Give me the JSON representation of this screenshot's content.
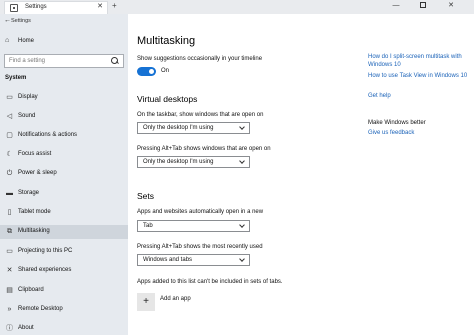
{
  "window": {
    "tab_title": "Settings",
    "tab_close": "✕",
    "new_tab": "+",
    "minimize": "—",
    "close": "✕"
  },
  "sidebar": {
    "back": "←",
    "title": "Settings",
    "home": "Home",
    "search_placeholder": "Find a setting",
    "section": "System",
    "items": [
      {
        "label": "Display",
        "icon": "display-icon"
      },
      {
        "label": "Sound",
        "icon": "speaker-icon"
      },
      {
        "label": "Notifications & actions",
        "icon": "notifications-icon"
      },
      {
        "label": "Focus assist",
        "icon": "moon-icon"
      },
      {
        "label": "Power & sleep",
        "icon": "power-icon"
      },
      {
        "label": "Storage",
        "icon": "storage-icon"
      },
      {
        "label": "Tablet mode",
        "icon": "tablet-icon"
      },
      {
        "label": "Multitasking",
        "icon": "multitasking-icon"
      },
      {
        "label": "Projecting to this PC",
        "icon": "projecting-icon"
      },
      {
        "label": "Shared experiences",
        "icon": "shared-icon"
      },
      {
        "label": "Clipboard",
        "icon": "clipboard-icon"
      },
      {
        "label": "Remote Desktop",
        "icon": "remote-desktop-icon"
      },
      {
        "label": "About",
        "icon": "info-icon"
      }
    ]
  },
  "main": {
    "title": "Multitasking",
    "timeline_label": "Show suggestions occasionally in your timeline",
    "toggle_state": "On",
    "virtual_desktops": {
      "heading": "Virtual desktops",
      "taskbar_label": "On the taskbar, show windows that are open on",
      "taskbar_value": "Only the desktop I'm using",
      "alttab_label": "Pressing Alt+Tab shows windows that are open on",
      "alttab_value": "Only the desktop I'm using"
    },
    "sets": {
      "heading": "Sets",
      "apps_label": "Apps and websites automatically open in a new",
      "apps_value": "Tab",
      "alttab_label": "Pressing Alt+Tab shows the most recently used",
      "alttab_value": "Windows and tabs",
      "exclusion_label": "Apps added to this list can't be included in sets of tabs.",
      "add_label": "Add an app"
    }
  },
  "right": {
    "link1": "How do I split-screen multitask with Windows 10",
    "link2": "How to use Task View in Windows 10",
    "link3": "Get help",
    "better_label": "Make Windows better",
    "feedback_link": "Give us feedback"
  },
  "colors": {
    "accent": "#1672d4",
    "link": "#1a62b8",
    "sidebar_bg": "#e6eaef",
    "active_item": "#cfd5dc"
  }
}
